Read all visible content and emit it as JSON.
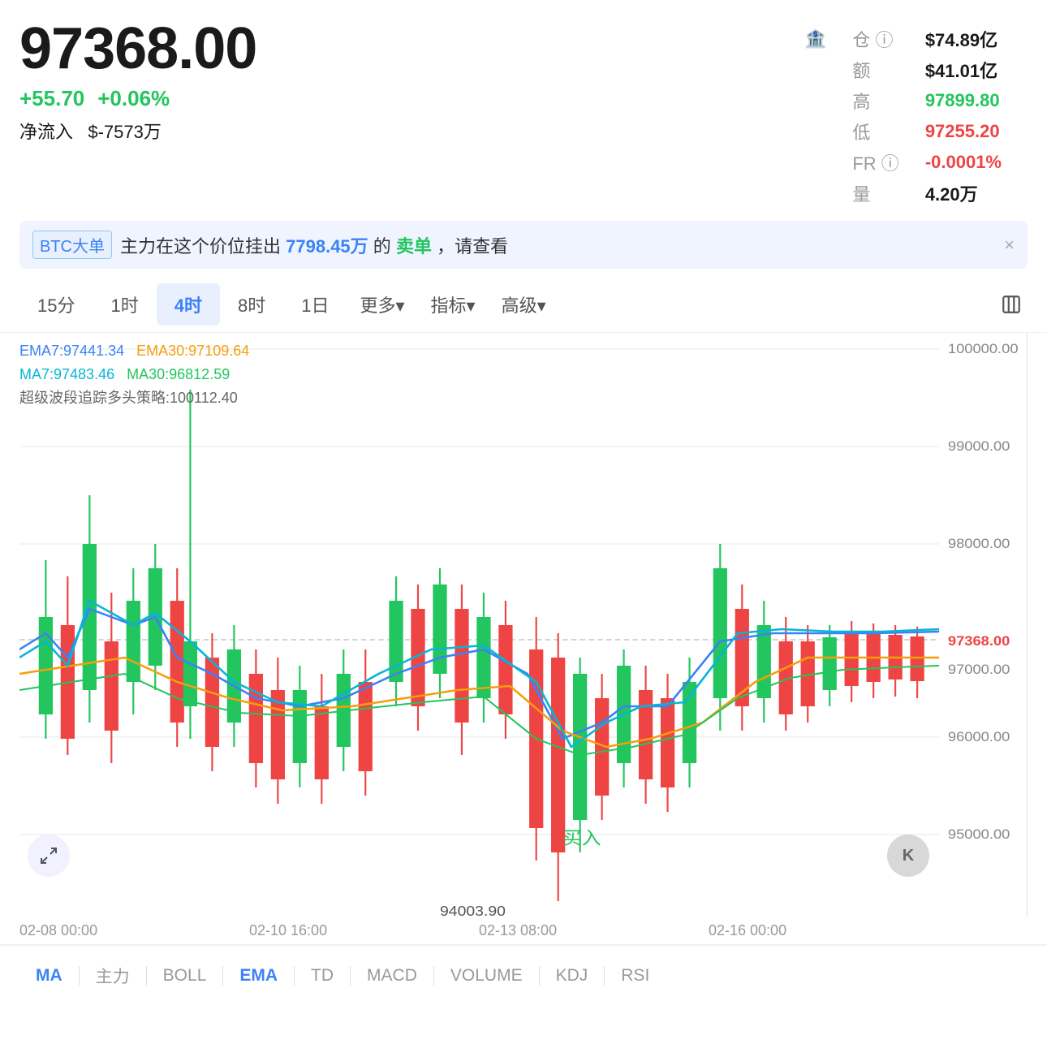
{
  "header": {
    "main_price": "97368.00",
    "change_abs": "+55.70",
    "change_pct": "+0.06%",
    "net_flow_label": "净流入",
    "net_flow_val": "$-7573万",
    "position_label": "仓",
    "position_val": "$74.89亿",
    "amount_label": "额",
    "amount_val": "$41.01亿",
    "high_label": "高",
    "high_val": "97899.80",
    "low_label": "低",
    "low_val": "97255.20",
    "fr_label": "FR",
    "fr_val": "-0.0001%",
    "vol_label": "量",
    "vol_val": "4.20万"
  },
  "alert": {
    "tag": "BTC大单",
    "text_pre": "主力在这个价位挂出",
    "num": "7798.45万",
    "text_mid": "的",
    "sell": "卖单",
    "text_post": "，请查看",
    "close": "×"
  },
  "timeframes": {
    "items": [
      "15分",
      "1时",
      "4时",
      "8时",
      "1日",
      "更多▾",
      "指标▾",
      "高级▾"
    ],
    "active": "4时"
  },
  "chart": {
    "indicators": {
      "ema7_label": "EMA7:",
      "ema7_val": "97441.34",
      "ema30_label": "EMA30:",
      "ema30_val": "97109.64",
      "ma7_label": "MA7:",
      "ma7_val": "97483.46",
      "ma30_label": "MA30:",
      "ma30_val": "96812.59",
      "super_label": "超级波段追踪多头策略:",
      "super_val": "100112.40"
    },
    "price_levels": [
      "100000.00",
      "99000.00",
      "98000.00",
      "97000.00",
      "96000.00",
      "95000.00"
    ],
    "current_price_label": "97368.00",
    "low_point_label": "94003.90",
    "buy_label": "买入",
    "time_labels": [
      "02-08 00:00",
      "02-10 16:00",
      "02-13 08:00",
      "02-16 00:00"
    ]
  },
  "indicators_bar": {
    "items": [
      "MA",
      "主力",
      "BOLL",
      "EMA",
      "TD",
      "MACD",
      "VOLUME",
      "KDJ",
      "RSI"
    ],
    "active": [
      "MA",
      "EMA"
    ]
  },
  "colors": {
    "green": "#22c55e",
    "red": "#ef4444",
    "blue": "#3b82f6",
    "yellow": "#f59e0b",
    "cyan": "#06b6d4",
    "ema7": "#3b82f6",
    "ema30": "#f59e0b",
    "ma7": "#06b6d4",
    "ma30": "#22c55e"
  }
}
